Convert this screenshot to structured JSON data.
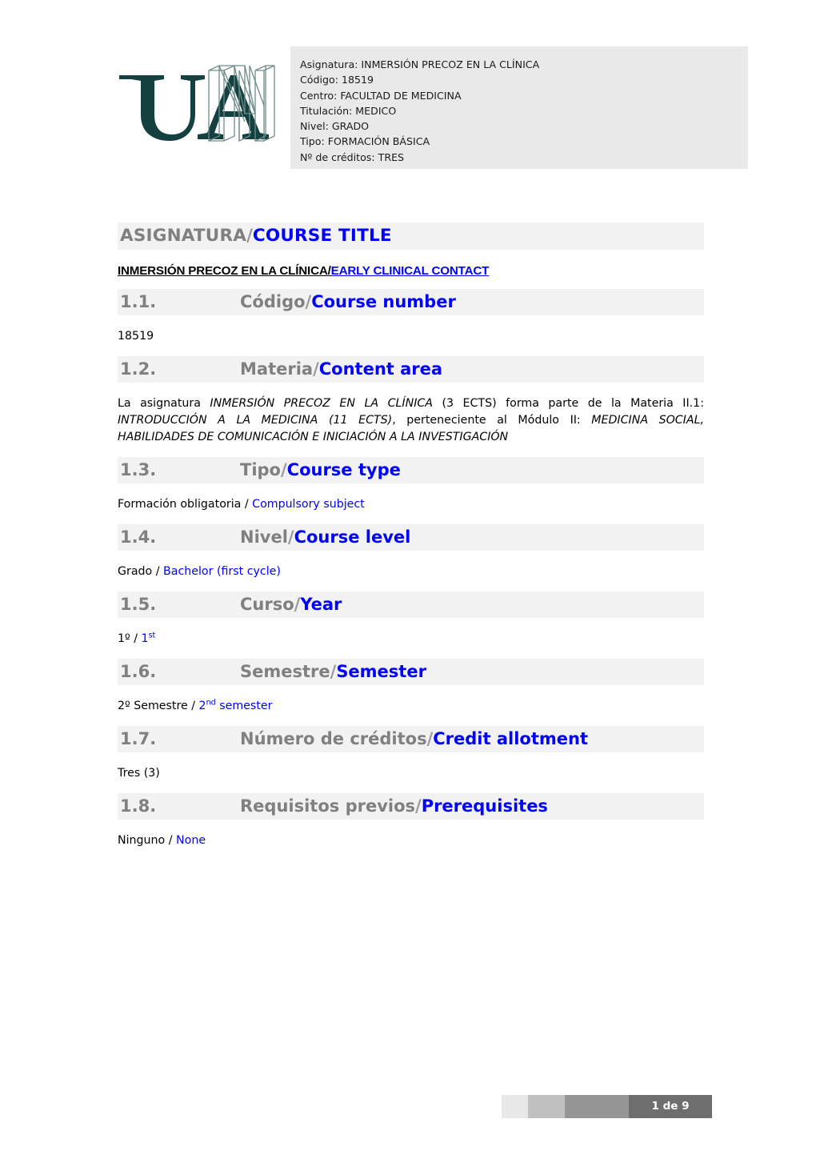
{
  "header": {
    "logo_alt": "UAM - Universidad Autónoma de Madrid",
    "info_lines": [
      "Asignatura: INMERSIÓN PRECOZ EN LA CLÍNICA",
      "Código: 18519",
      "Centro: FACULTAD DE MEDICINA",
      "Titulación: MEDICO",
      "Nivel: GRADO",
      "Tipo: FORMACIÓN BÁSICA",
      "Nº de créditos: TRES"
    ]
  },
  "title": {
    "es": "ASIGNATURA",
    "separator": "/",
    "en": "COURSE TITLE"
  },
  "subtitle": {
    "es": "INMERSIÓN PRECOZ EN LA CLÍNICA",
    "separator": "/",
    "en": "EARLY CLINICAL CONTACT"
  },
  "sections": {
    "s1": {
      "number": "1.1.",
      "es": "Código",
      "separator": "/",
      "en": "Course number",
      "value": "18519"
    },
    "s2": {
      "number": "1.2.",
      "es": "Materia",
      "separator": "/",
      "en": "Content area",
      "body": {
        "t1": "La asignatura ",
        "i1": "INMERSIÓN PRECOZ EN LA CLÍNICA",
        "t2": " (3 ECTS) forma parte de la Materia  II.1: ",
        "i2": "INTRODUCCIÓN A LA MEDICINA (11 ECTS)",
        "t3": ", perteneciente al Módulo II: ",
        "i3": "MEDICINA SOCIAL, HABILIDADES DE COMUNICACIÓN E INICIACIÓN A LA INVESTIGACIÓN"
      }
    },
    "s3": {
      "number": "1.3.",
      "es": "Tipo",
      "separator": "/",
      "en": "Course type",
      "value_es": "Formación obligatoria",
      "value_sep": " / ",
      "value_en": "Compulsory subject"
    },
    "s4": {
      "number": "1.4.",
      "es": "Nivel",
      "separator": "/",
      "en": "Course level",
      "value_es": "Grado",
      "value_sep": " / ",
      "value_en": "Bachelor (first cycle)"
    },
    "s5": {
      "number": "1.5.",
      "es": "Curso",
      "separator": "/",
      "en": "Year",
      "value_es": "1º",
      "value_sep": " / ",
      "value_en_base": "1",
      "value_en_sup": "st"
    },
    "s6": {
      "number": "1.6.",
      "es": "Semestre",
      "separator": "/",
      "en": "Semester",
      "value_es": "2º Semestre",
      "value_sep": " / ",
      "value_en_base": "2",
      "value_en_sup": "nd",
      "value_en_rest": " semester"
    },
    "s7": {
      "number": "1.7.",
      "es": "Número de créditos",
      "separator": "/",
      "en": "Credit allotment",
      "value": "Tres (3)"
    },
    "s8": {
      "number": "1.8.",
      "es": "Requisitos previos",
      "separator": "/",
      "en": "Prerequisites",
      "value_es": "Ninguno",
      "value_sep": " / ",
      "value_en": "None"
    }
  },
  "footer": {
    "page_label": "1 de 9"
  },
  "colors": {
    "heading_spanish": "#808080",
    "heading_english": "#0000ff",
    "heading_bar_bg": "#f2f2f2",
    "header_box_bg": "#e9e9e9",
    "logo_teal": "#14413f",
    "footer_dark": "#6e6e6e"
  }
}
